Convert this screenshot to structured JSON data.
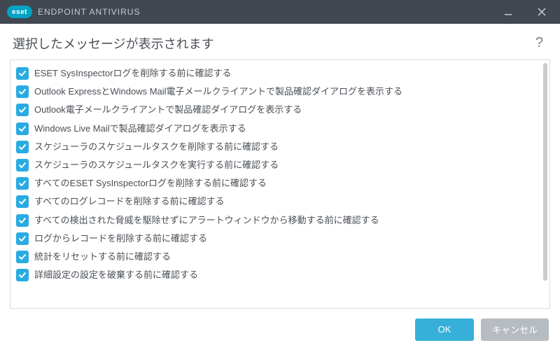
{
  "brand": {
    "badge": "eset",
    "product": "ENDPOINT ANTIVIRUS"
  },
  "page_title": "選択したメッセージが表示されます",
  "help_label": "?",
  "items": [
    {
      "checked": true,
      "label": "ESET SysInspectorログを削除する前に確認する"
    },
    {
      "checked": true,
      "label": "Outlook ExpressとWindows Mail電子メールクライアントで製品確認ダイアログを表示する"
    },
    {
      "checked": true,
      "label": "Outlook電子メールクライアントで製品確認ダイアログを表示する"
    },
    {
      "checked": true,
      "label": "Windows Live Mailで製品確認ダイアログを表示する"
    },
    {
      "checked": true,
      "label": "スケジューラのスケジュールタスクを削除する前に確認する"
    },
    {
      "checked": true,
      "label": "スケジューラのスケジュールタスクを実行する前に確認する"
    },
    {
      "checked": true,
      "label": "すべてのESET SysInspectorログを削除する前に確認する"
    },
    {
      "checked": true,
      "label": "すべてのログレコードを削除する前に確認する"
    },
    {
      "checked": true,
      "label": "すべての検出された脅威を駆除せずにアラートウィンドウから移動する前に確認する"
    },
    {
      "checked": true,
      "label": "ログからレコードを削除する前に確認する"
    },
    {
      "checked": true,
      "label": "統計をリセットする前に確認する"
    },
    {
      "checked": true,
      "label": "詳細設定の設定を破棄する前に確認する"
    }
  ],
  "buttons": {
    "ok": "OK",
    "cancel": "キャンセル"
  }
}
